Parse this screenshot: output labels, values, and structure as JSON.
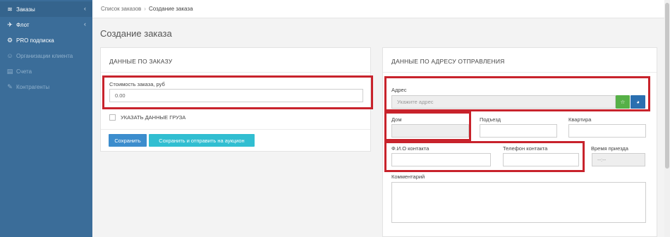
{
  "sidebar": {
    "items": [
      {
        "icon": "stack-icon",
        "glyph": "≋",
        "label": "Заказы",
        "chevron": "‹"
      },
      {
        "icon": "rocket-icon",
        "glyph": "✈",
        "label": "Флот",
        "chevron": "‹"
      },
      {
        "icon": "gear-icon",
        "glyph": "⚙",
        "label": "PRO подписка"
      },
      {
        "icon": "users-icon",
        "glyph": "☺",
        "label": "Организации клиента"
      },
      {
        "icon": "invoice-icon",
        "glyph": "▤",
        "label": "Счета"
      },
      {
        "icon": "handshake-icon",
        "glyph": "✎",
        "label": "Контрагенты"
      }
    ]
  },
  "breadcrumb": {
    "parent": "Список заказов",
    "separator": "›",
    "current": "Создание заказа"
  },
  "page": {
    "title": "Создание заказа"
  },
  "order_panel": {
    "heading": "ДАННЫЕ ПО ЗАКАЗУ",
    "cost_label": "Стоимость заказа, руб",
    "cost_value": "0.00",
    "cargo_checkbox_label": "УКАЗАТЬ ДАННЫЕ ГРУЗА",
    "save_label": "Сохранить",
    "save_auction_label": "Сохранить и отправить на аукцион"
  },
  "address_panel": {
    "heading": "ДАННЫЕ ПО АДРЕСУ ОТПРАВЛЕНИЯ",
    "address_label": "Адрес",
    "address_placeholder": "Укажите адрес",
    "favorite_glyph": "☆",
    "map_glyph": "◕",
    "house_label": "Дом",
    "entrance_label": "Подъезд",
    "apartment_label": "Квартира",
    "contact_name_label": "Ф.И.О контакта",
    "contact_phone_label": "Телефон контакта",
    "arrival_time_label": "Время приезда",
    "arrival_time_value": "--:--",
    "comment_label": "Комментарий"
  },
  "colors": {
    "sidebar": "#3b6d99",
    "highlight": "#c8232c",
    "primary_button": "#3c8dcd",
    "auction_button": "#31bed1"
  }
}
